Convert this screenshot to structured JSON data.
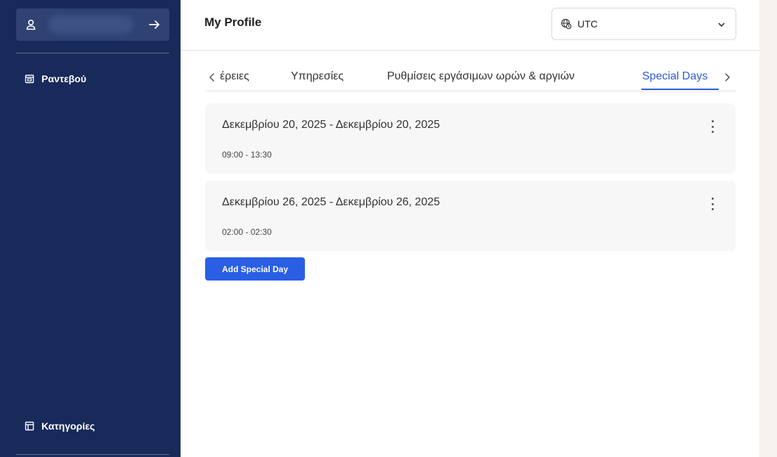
{
  "sidebar": {
    "items": [
      {
        "label": "Ραντεβού",
        "icon": "calendar-icon"
      },
      {
        "label": "Κατηγορίες",
        "icon": "layout-icon"
      }
    ],
    "bg": "#172a5a"
  },
  "header": {
    "title": "My Profile",
    "timezone": {
      "value": "UTC"
    }
  },
  "tabs": [
    {
      "label": "έρειες",
      "active": false
    },
    {
      "label": "Υπηρεσίες",
      "active": false
    },
    {
      "label": "Ρυθμίσεις εργάσιμων ωρών & αργιών",
      "active": false
    },
    {
      "label": "Special Days",
      "active": true
    }
  ],
  "special_days": [
    {
      "range": "Δεκεμβρίου 20, 2025 - Δεκεμβρίου 20, 2025",
      "time": "09:00 - 13:30"
    },
    {
      "range": "Δεκεμβρίου 26, 2025 - Δεκεμβρίου 26, 2025",
      "time": "02:00 - 02:30"
    }
  ],
  "add_button": {
    "label": "Add Special Day"
  },
  "colors": {
    "accent": "#2a5bd7",
    "button": "#2a5fe5",
    "card_bg": "#f7f7f7"
  }
}
